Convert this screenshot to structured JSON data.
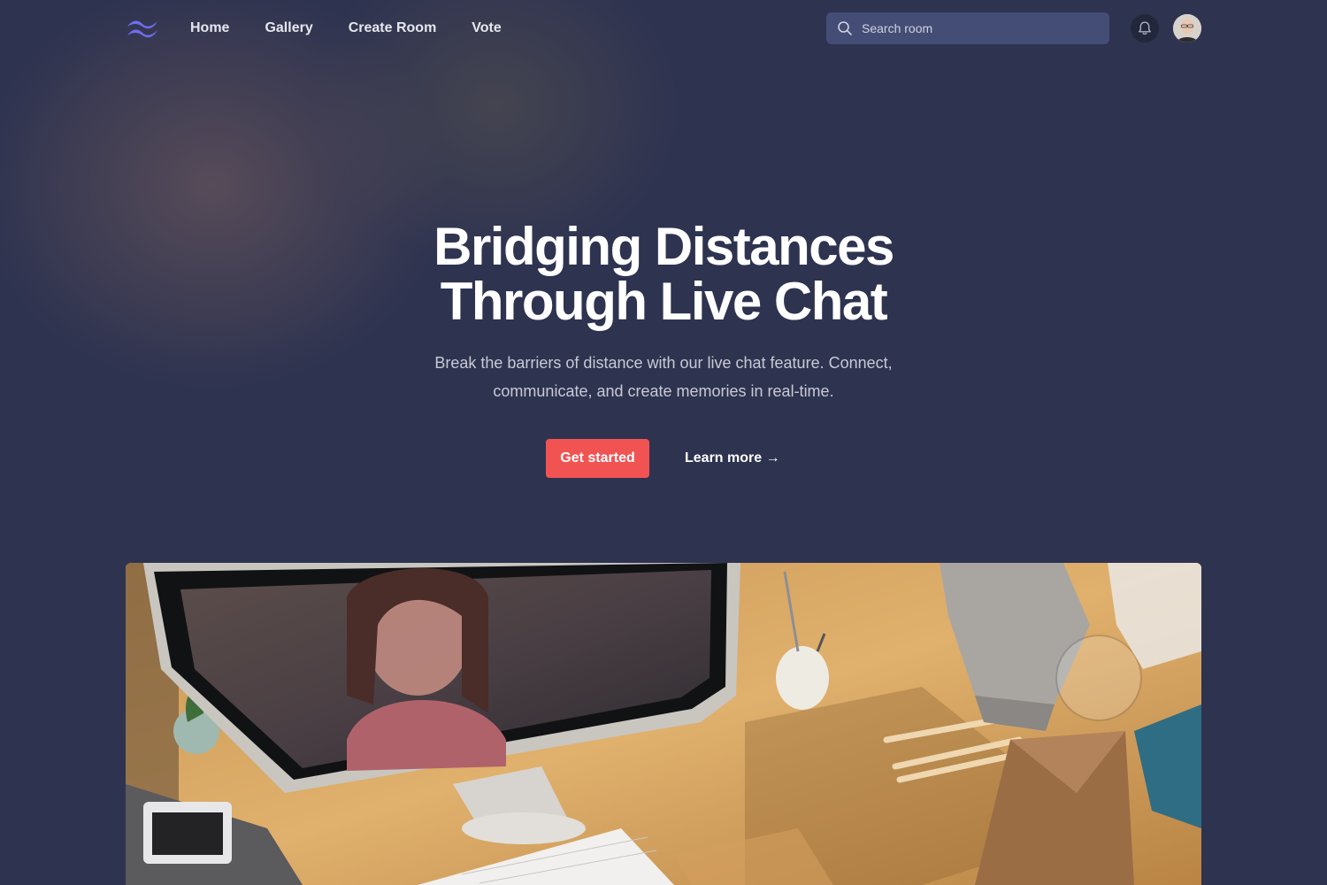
{
  "nav": {
    "links": [
      "Home",
      "Gallery",
      "Create Room",
      "Vote"
    ],
    "search": {
      "placeholder": "Search room",
      "value": ""
    }
  },
  "hero": {
    "title_line1": "Bridging Distances",
    "title_line2": "Through Live Chat",
    "subtitle": "Break the barriers of distance with our live chat feature. Connect, communicate, and create memories in real-time.",
    "primary_cta": "Get started",
    "secondary_cta": "Learn more →"
  },
  "colors": {
    "background": "#2e3350",
    "accent": "#f15353",
    "logo": "#6f6df0",
    "search_bg": "#444d75"
  },
  "icons": [
    "logo-waves-icon",
    "search-icon",
    "bell-icon"
  ]
}
